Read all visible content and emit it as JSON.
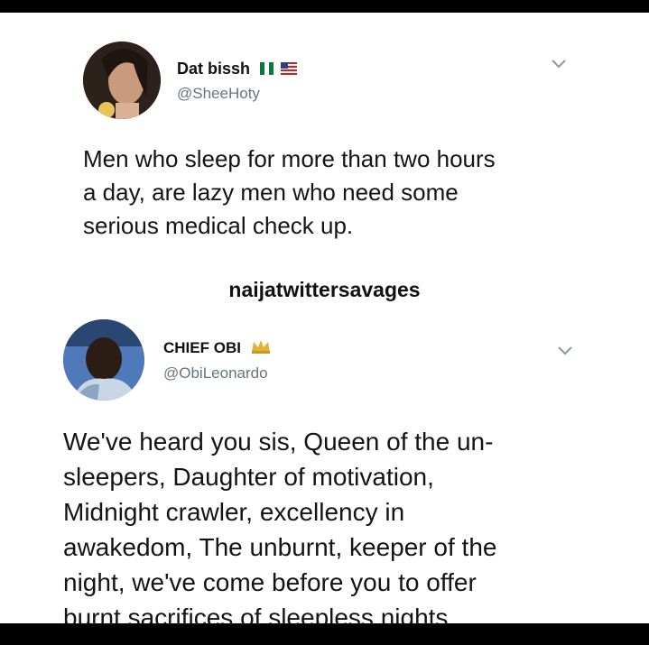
{
  "tweet1": {
    "display_name": "Dat bissh",
    "badges": [
      "nigeria-flag-icon",
      "us-flag-icon"
    ],
    "handle": "@SheeHoty",
    "text": "Men who sleep for more than two hours\na day, are lazy men who need some\nserious medical check up."
  },
  "watermark": "naijatwittersavages",
  "tweet2": {
    "display_name": "CHIEF OBI",
    "badges": [
      "crown-icon"
    ],
    "handle": "@ObiLeonardo",
    "text": "We've heard you sis, Queen of the un-\nsleepers, Daughter of motivation,\nMidnight crawler, excellency in\nawakedom, The unburnt, keeper of the\nnight, we've come before you to offer\nburnt sacrifices of sleepless nights."
  }
}
